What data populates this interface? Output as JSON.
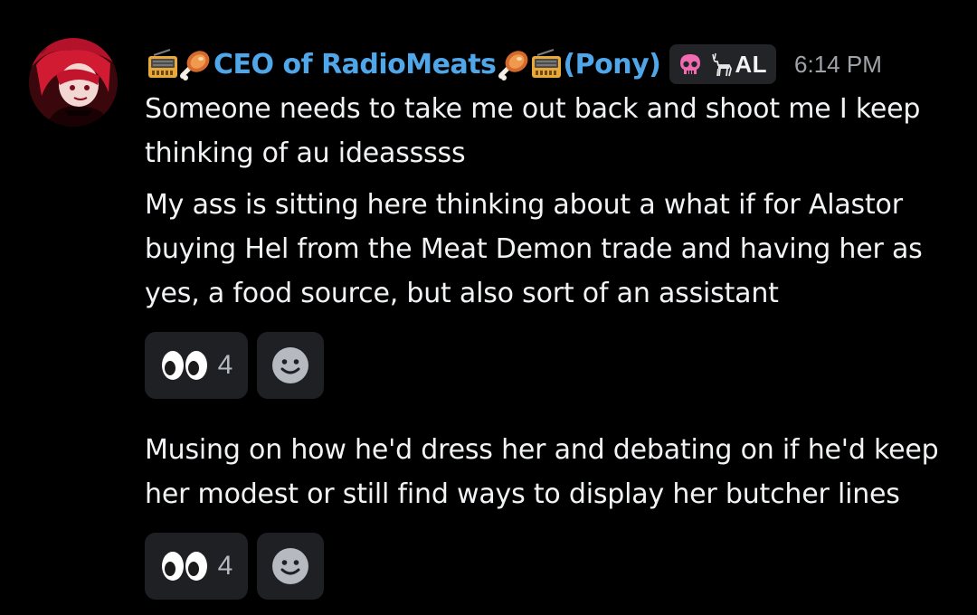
{
  "message": {
    "author": {
      "name_main": "CEO of RadioMeats",
      "name_suffix": "(Pony)",
      "decor_icons": [
        "radio-icon",
        "meat-icon"
      ],
      "tag_text": "AL",
      "tag_icons": [
        "skull-icon",
        "deer-icon"
      ],
      "name_color": "#4fa6e8"
    },
    "timestamp": "6:14 PM",
    "paragraphs": [
      "Someone needs to take me out back and shoot me I keep thinking of au ideasssss",
      "My ass is sitting here thinking about a what if for Alastor buying Hel from the Meat Demon trade and having her as yes, a food source, but also sort of an assistant",
      "Musing on how he'd dress her and debating on if he'd keep her modest or still find ways to display her butcher lines"
    ],
    "reaction_groups": [
      {
        "emoji": "eyes-icon",
        "count": "4"
      },
      {
        "emoji": "eyes-icon",
        "count": "4"
      }
    ]
  },
  "colors": {
    "background": "#000000",
    "text": "#f2f3f5",
    "timestamp": "#a0a3a8",
    "reaction_bg": "#1f2023",
    "tag_bg": "#232428"
  }
}
